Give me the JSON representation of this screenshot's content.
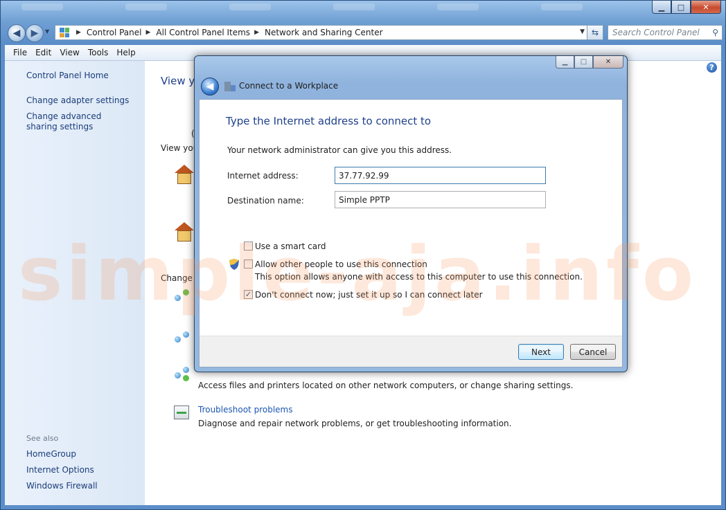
{
  "window": {
    "caption_buttons": {
      "minimize": "▁",
      "maximize": "□",
      "close": "✕"
    }
  },
  "navigation": {
    "back_glyph": "◀",
    "forward_glyph": "▶",
    "breadcrumbs": [
      "Control Panel",
      "All Control Panel Items",
      "Network and Sharing Center"
    ],
    "search_placeholder": "Search Control Panel"
  },
  "menubar": [
    "File",
    "Edit",
    "View",
    "Tools",
    "Help"
  ],
  "left_pane": {
    "links": [
      "Control Panel Home",
      "Change adapter settings",
      "Change advanced sharing settings"
    ],
    "see_also_label": "See also",
    "see_also": [
      "HomeGroup",
      "Internet Options",
      "Windows Firewall"
    ]
  },
  "main_pane": {
    "title": "View yo",
    "partial_text_1": "View you",
    "partial_text_2": "Change y",
    "paren": "(",
    "share_desc": "Access files and printers located on other network computers, or change sharing settings.",
    "troubleshoot_link": "Troubleshoot problems",
    "troubleshoot_desc": "Diagnose and repair network problems, or get troubleshooting information."
  },
  "dialog": {
    "title": "Connect to a Workplace",
    "heading": "Type the Internet address to connect to",
    "intro": "Your network administrator can give you this address.",
    "internet_address_label": "Internet address:",
    "internet_address_value": "37.77.92.99",
    "destination_label": "Destination name:",
    "destination_value": "Simple PPTP",
    "smart_card_label": "Use a smart card",
    "smart_card_checked": false,
    "allow_others_label": "Allow other people to use this connection",
    "allow_others_checked": false,
    "allow_others_desc": "This option allows anyone with access to this computer to use this connection.",
    "dont_connect_label": "Don't connect now; just set it up so I can connect later",
    "dont_connect_checked": true,
    "next_label": "Next",
    "cancel_label": "Cancel"
  },
  "watermark": "simple-aja.info"
}
